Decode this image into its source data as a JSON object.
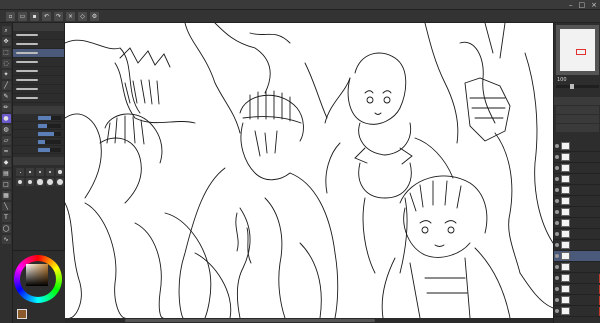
{
  "window": {
    "title": "",
    "controls": [
      "–",
      "□",
      "×"
    ]
  },
  "menu": [
    "",
    "",
    "",
    "",
    "",
    "",
    "",
    "",
    "",
    "",
    ""
  ],
  "subtool_panel": {
    "brushes": [
      "",
      "",
      "",
      "",
      "",
      "",
      "",
      ""
    ],
    "properties": [
      {
        "label": "",
        "fill": 0.55
      },
      {
        "label": "",
        "fill": 0.4
      },
      {
        "label": "",
        "fill": 0.7
      },
      {
        "label": "",
        "fill": 0.3
      },
      {
        "label": "",
        "fill": 0.5
      }
    ],
    "sizes": [
      "0.7",
      "1",
      "1.5",
      "2",
      "2.5",
      "3",
      "4",
      "5",
      "6",
      "7"
    ]
  },
  "navigator": {
    "zoom": "100"
  },
  "layers": {
    "tabs": "",
    "items": [
      {
        "name": "",
        "selected": false
      },
      {
        "name": "",
        "selected": false
      },
      {
        "name": "",
        "selected": false
      },
      {
        "name": "",
        "selected": false
      },
      {
        "name": "",
        "selected": false
      },
      {
        "name": "",
        "selected": false
      },
      {
        "name": "",
        "selected": false
      },
      {
        "name": "",
        "selected": false
      },
      {
        "name": "",
        "selected": false
      },
      {
        "name": "",
        "selected": false
      },
      {
        "name": "",
        "selected": true
      },
      {
        "name": "",
        "selected": false
      },
      {
        "name": "",
        "selected": false
      },
      {
        "name": "",
        "selected": false
      },
      {
        "name": "",
        "selected": false
      },
      {
        "name": "",
        "selected": false
      }
    ]
  },
  "colors": {
    "main": "#8a5a2b",
    "sub": "#ffffff",
    "accent": "#4b5a7a"
  }
}
